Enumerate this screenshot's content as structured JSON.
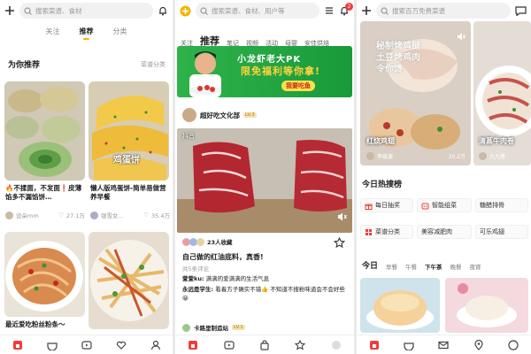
{
  "panel1": {
    "search_placeholder": "搜索菜谱、食材",
    "tabs": [
      "关注",
      "推荐",
      "分类"
    ],
    "section_title": "为你推荐",
    "section_link": "菜谱分类",
    "cards": [
      {
        "title": "🔥不揉面，不发面❗皮薄馅多不漏馅饼…",
        "author": "设朵mm",
        "likes": "27.1万"
      },
      {
        "title": "懒人版鸡蛋饼-简单易做营养早餐",
        "author": "银雪女…",
        "likes": "35.4万"
      },
      {
        "title": "最近爱吃粉丝粉条～",
        "author": "",
        "likes": ""
      }
    ],
    "card2_overlay": "鸡蛋饼"
  },
  "panel2": {
    "search_placeholder": "搜索菜谱、食材、用户等",
    "badge": "2",
    "tabs": [
      "关注",
      "推荐",
      "笔记",
      "视频",
      "活动",
      "母婴",
      "安佳烘焙"
    ],
    "banner": {
      "line1": "小龙虾老大PK",
      "line2": "限免福利等你拿!",
      "button": "我要吃鱼"
    },
    "post_author": "超好吃文化部",
    "post_level": "LV.3",
    "video_label": "抖音",
    "favorites": "23人收藏",
    "post_title": "自己做的红油底料，真香!",
    "post_subtitle": "共5条评论",
    "comments": [
      {
        "user": "萱萱ku:",
        "text": "满满的爱满满的生活气息"
      },
      {
        "user": "永远是学生:",
        "text": "看着方子确实不错👍 不知道不搜粉味道会不会好些😀"
      }
    ],
    "footer_user": "卡路里制造站",
    "footer_level": "LV.1"
  },
  "panel3": {
    "search_placeholder": "搜索百万免费菜谱",
    "hot_cards": [
      {
        "overlay": "秘制烤鸡腿\n土豆烤鸡肉\n令你馋",
        "caption": "红烧鸡翅",
        "author": "李媛酱",
        "likes": "20.2万"
      },
      {
        "overlay": "",
        "caption": "清蒸牛肉卷",
        "author": "九九猪",
        "likes": ""
      }
    ],
    "hot_title": "今日热搜榜",
    "chips": [
      {
        "icon": "gift-icon",
        "label": "每日抽奖"
      },
      {
        "icon": "robot-icon",
        "label": "智能组菜"
      },
      {
        "icon": "",
        "label": "糖醋排骨"
      },
      {
        "icon": "grid-icon",
        "label": "菜谱分类"
      },
      {
        "icon": "",
        "label": "美容减肥肉"
      },
      {
        "icon": "",
        "label": "可乐鸡翅"
      }
    ],
    "day_tabs": [
      "今日",
      "早餐",
      "午餐",
      "下午茶",
      "晚餐",
      "夜宵"
    ]
  },
  "colors": {
    "accent": "#f6b300",
    "red": "#f23c3c",
    "green": "#2fb24a"
  }
}
